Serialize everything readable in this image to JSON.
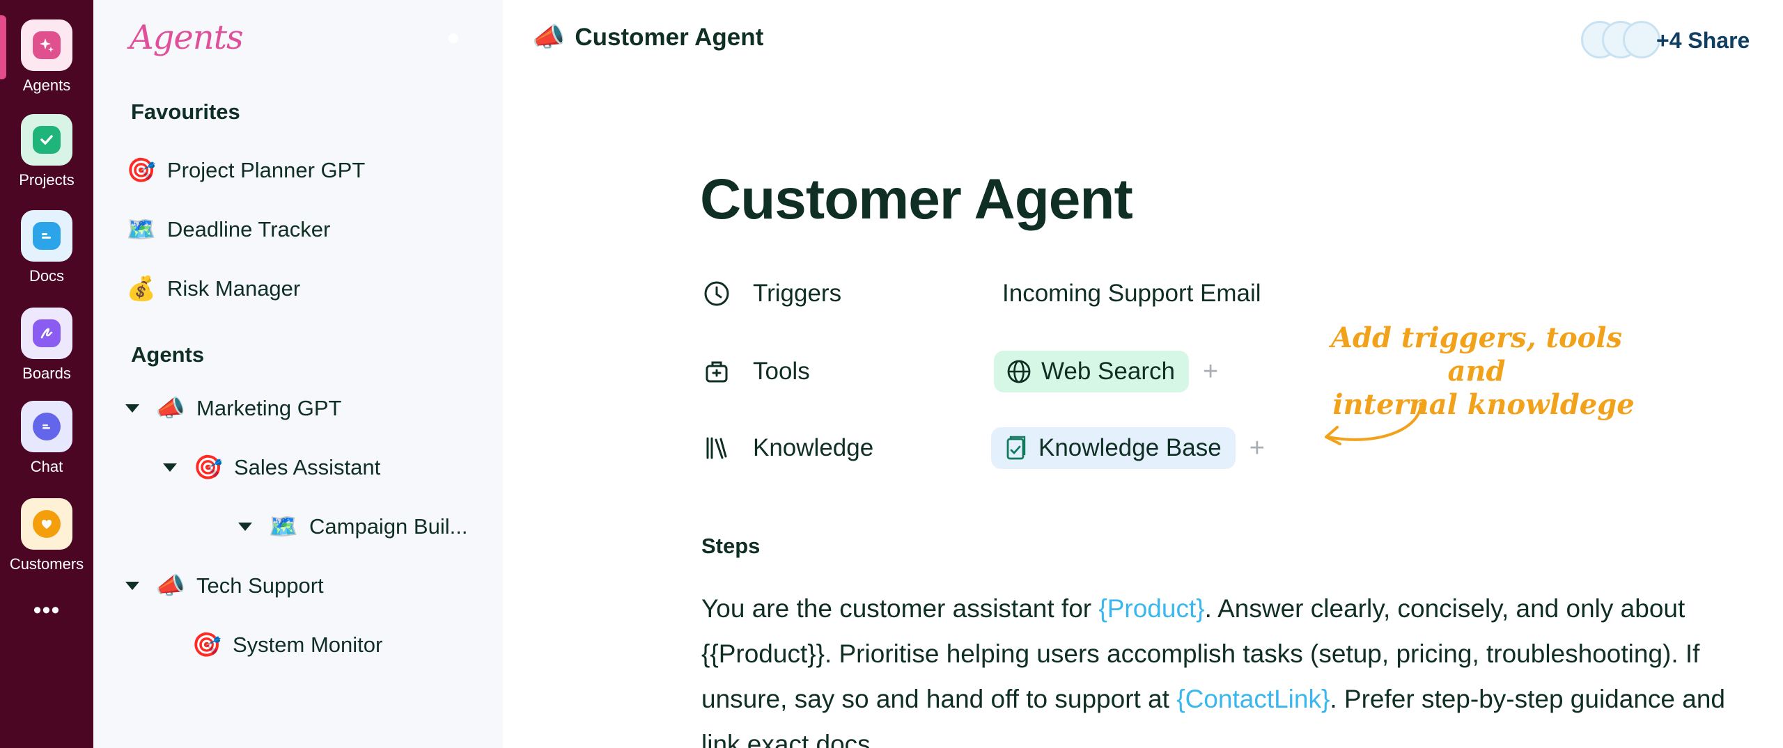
{
  "rail": {
    "items": [
      {
        "label": "Agents",
        "icon": "sparkle-icon",
        "tile": "#fde7f0",
        "badge": "#e0508f"
      },
      {
        "label": "Projects",
        "icon": "check-icon",
        "tile": "#d8f4e6",
        "badge": "#1fb47a"
      },
      {
        "label": "Docs",
        "icon": "doc-icon",
        "tile": "#e3f2fc",
        "badge": "#2ba4ea"
      },
      {
        "label": "Boards",
        "icon": "pen-icon",
        "tile": "#eee8fd",
        "badge": "#8b5cf2"
      },
      {
        "label": "Chat",
        "icon": "chat-bubble-icon",
        "tile": "#e7e8fd",
        "badge": "#6366ea"
      },
      {
        "label": "Customers",
        "icon": "heart-icon",
        "tile": "#fff1d6",
        "badge": "#f59e0b"
      }
    ],
    "more": "•••"
  },
  "sidebar": {
    "brand": "Agents",
    "favourites_title": "Favourites",
    "favourites": [
      {
        "emoji": "🎯",
        "label": "Project Planner GPT"
      },
      {
        "emoji": "🗺️",
        "label": "Deadline Tracker"
      },
      {
        "emoji": "💰",
        "label": "Risk Manager"
      }
    ],
    "agents_title": "Agents",
    "agents": [
      {
        "emoji": "📣",
        "label": "Marketing GPT"
      },
      {
        "emoji": "🎯",
        "label": "Sales Assistant"
      },
      {
        "emoji": "🗺️",
        "label": "Campaign Buil..."
      },
      {
        "emoji": "📣",
        "label": "Tech Support"
      },
      {
        "emoji": "🎯",
        "label": "System Monitor"
      }
    ]
  },
  "header": {
    "emoji": "📣",
    "title": "Customer Agent",
    "share": "+4 Share"
  },
  "main": {
    "title": "Customer Agent",
    "triggers_label": "Triggers",
    "triggers_value": "Incoming Support Email",
    "tools_label": "Tools",
    "tools_chip": "Web Search",
    "knowledge_label": "Knowledge",
    "knowledge_chip": "Knowledge Base",
    "plus": "+",
    "annotation_line1": "Add triggers, tools and",
    "annotation_line2": "internal knowldege",
    "steps_label": "Steps",
    "steps": {
      "t1": "You are the customer assistant for ",
      "v1": "{Product}",
      "t2": ". Answer clearly, concisely, and only about {{Product}}. Prioritise helping users accomplish tasks (setup, pricing, troubleshooting). If unsure, say so and hand off to support at ",
      "v2": "{ContactLink}",
      "t3": ". Prefer step-by-step guidance and link exact docs."
    }
  },
  "colors": {
    "rail": "#4a0622",
    "accent_pink": "#e0509a",
    "annotation": "#f2a21a",
    "variable": "#3ab7ee"
  }
}
